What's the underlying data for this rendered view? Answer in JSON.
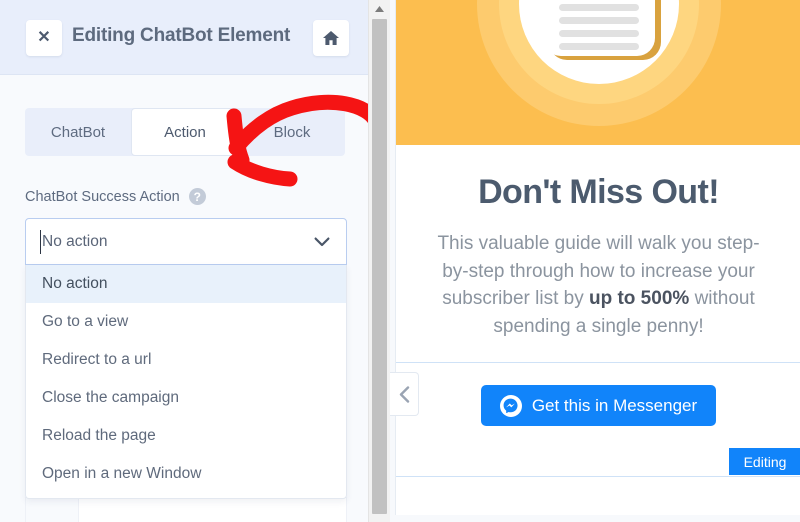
{
  "editor": {
    "header": {
      "close_label": "✕",
      "title": "Editing ChatBot Element",
      "home_icon": "home-icon"
    },
    "tabs": [
      {
        "label": "ChatBot",
        "active": false
      },
      {
        "label": "Action",
        "active": true
      },
      {
        "label": "Block",
        "active": false
      }
    ],
    "field": {
      "label": "ChatBot Success Action",
      "help_icon": "?",
      "selected_value": "No action",
      "chevron_icon": "chevron-down-icon",
      "options": [
        "No action",
        "Go to a view",
        "Redirect to a url",
        "Close the campaign",
        "Reload the page",
        "Open in a new Window"
      ],
      "selected_index": 0
    },
    "annotation": {
      "type": "red-curved-arrow",
      "color": "#f51414",
      "points_to": "Action tab"
    },
    "scrollbar": {
      "up_arrow_icon": "scroll-up-arrow-icon",
      "thumb": "scrollbar-thumb"
    }
  },
  "preview": {
    "hero": {
      "background_color": "#fcbe4f",
      "illustration": "document-in-circle-illustration",
      "doc_lines": 4
    },
    "headline": "Don't Miss Out!",
    "body_part1": "This valuable guide will walk you step-by-step through how to increase your subscriber list by ",
    "body_highlight": "up to 500%",
    "body_part2": " without spending a single penny!",
    "cta": {
      "label": "Get this in Messenger",
      "icon": "messenger-icon",
      "color": "#1184fa"
    },
    "badge": {
      "label": "Editing",
      "color": "#1184fa"
    },
    "collapse_handle_icon": "chevron-left-icon"
  }
}
